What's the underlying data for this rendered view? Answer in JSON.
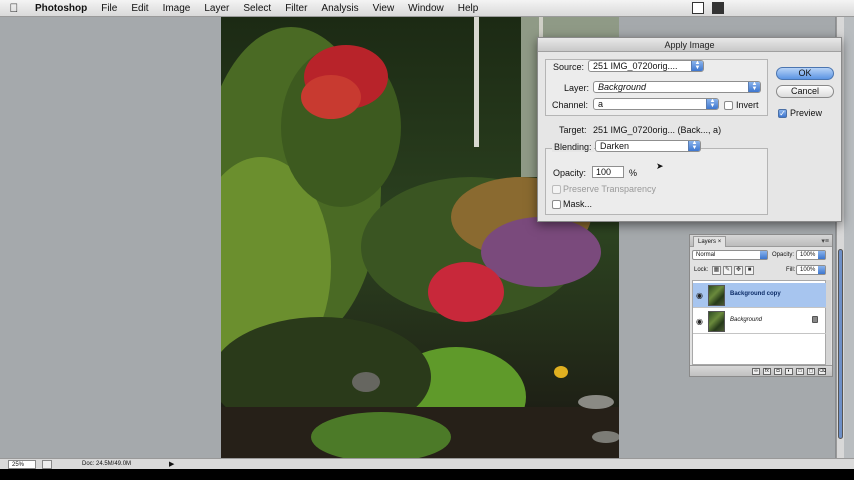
{
  "menubar": {
    "apple_glyph": "",
    "app_name": "Photoshop",
    "items": [
      "File",
      "Edit",
      "Image",
      "Layer",
      "Select",
      "Filter",
      "Analysis",
      "View",
      "Window",
      "Help"
    ]
  },
  "apply_image": {
    "title": "Apply Image",
    "source_label": "Source:",
    "source_value": "251 IMG_0720orig....",
    "layer_label": "Layer:",
    "layer_value": "Background",
    "channel_label": "Channel:",
    "channel_value": "a",
    "invert_label": "Invert",
    "invert_checked": false,
    "target_label": "Target:",
    "target_value": "251 IMG_0720orig... (Back..., a)",
    "blending_label": "Blending:",
    "blending_value": "Darken",
    "opacity_label": "Opacity:",
    "opacity_value": "100",
    "opacity_unit": "%",
    "preserve_transparency_label": "Preserve Transparency",
    "mask_label": "Mask...",
    "ok_label": "OK",
    "cancel_label": "Cancel",
    "preview_label": "Preview",
    "preview_checked": true
  },
  "layers_panel": {
    "tab_label": "Layers",
    "tab_close": "×",
    "blend_mode": "Normal",
    "opacity_label": "Opacity:",
    "opacity_value": "100%",
    "lock_label": "Lock:",
    "fill_label": "Fill:",
    "fill_value": "100%",
    "layers": [
      {
        "name": "Background copy",
        "selected": true,
        "visible": true,
        "locked": false
      },
      {
        "name": "Background",
        "selected": false,
        "visible": true,
        "locked": true
      }
    ]
  },
  "statusbar": {
    "zoom": "25%",
    "doc_info": "Doc: 24.5M/49.0M"
  },
  "colors": {
    "accent_blue": "#3d76cf",
    "selection": "#a7c5ef",
    "workspace": "#a5a9ac"
  }
}
